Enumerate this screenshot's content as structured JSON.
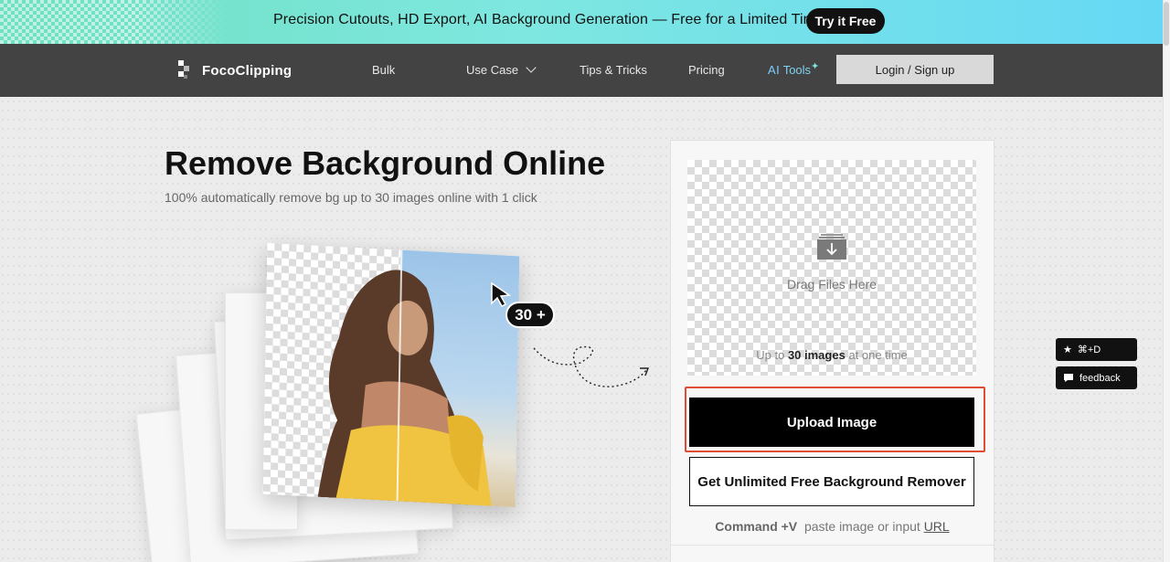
{
  "promo": {
    "text": "Precision Cutouts, HD Export, AI Background Generation — Free for a Limited Time",
    "button": "Try it Free"
  },
  "nav": {
    "logo": "FocoClipping",
    "items": [
      "Bulk",
      "Use Case",
      "Tips & Tricks",
      "Pricing"
    ],
    "ai_prefix": "AI",
    "ai_label": "Tools",
    "login": "Login / Sign up"
  },
  "hero": {
    "title": "Remove Background Online",
    "subtitle": "100% automatically remove bg up to 30 images online with 1 click",
    "badge": "30 +"
  },
  "upload": {
    "drag_text": "Drag Files Here",
    "note_prefix": "Up to",
    "note_bold": "30 images",
    "note_suffix": "at one time",
    "upload_button": "Upload Image",
    "unlimited_button": "Get Unlimited Free Background Remover",
    "paste_shortcut": "Command +V",
    "paste_text": "paste image or input",
    "paste_link": "URL"
  },
  "side": {
    "bookmark": "⌘+D",
    "feedback": "feedback"
  },
  "colors": {
    "promo_start": "#6fe0c0",
    "promo_end": "#66d8f5",
    "nav_bg": "#434343",
    "highlight": "#e04b34"
  }
}
